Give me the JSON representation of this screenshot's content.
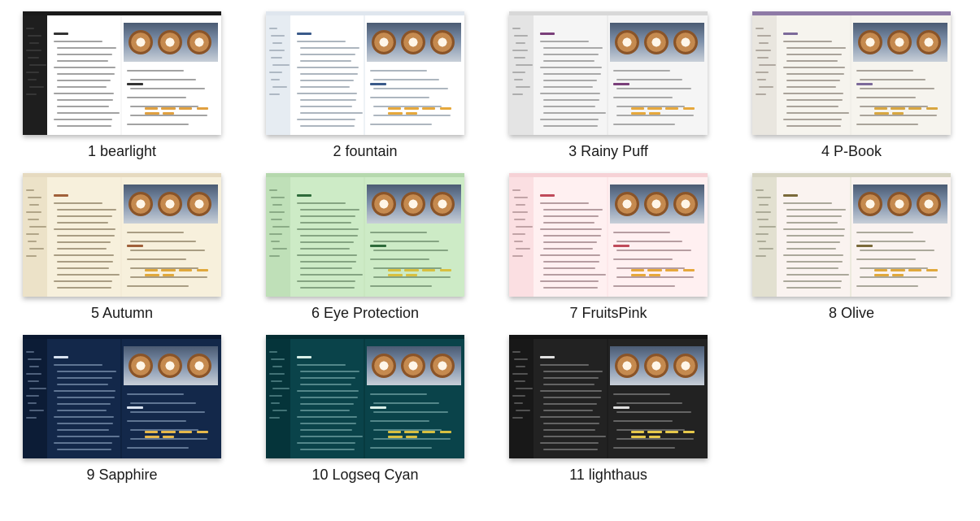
{
  "themes": [
    {
      "label": "1 bearlight",
      "bg": "#f7f7f7",
      "sidebar": "#1e1e1e",
      "page": "#ffffff",
      "text": "#555555",
      "heading": "#333333",
      "accent": "#e0a040",
      "topbar": "#1a1a1a"
    },
    {
      "label": "2 fountain",
      "bg": "#eef2f6",
      "sidebar": "#e6ecf2",
      "page": "#ffffff",
      "text": "#6a7a8a",
      "heading": "#3a5a8a",
      "accent": "#e6a83c",
      "topbar": "#dfe6ee"
    },
    {
      "label": "3 Rainy Puff",
      "bg": "#ececec",
      "sidebar": "#e4e4e4",
      "page": "#f5f5f5",
      "text": "#6a6a6a",
      "heading": "#7a3f7a",
      "accent": "#e6a83c",
      "topbar": "#d8d8d8"
    },
    {
      "label": "4 P-Book",
      "bg": "#f1efe9",
      "sidebar": "#e9e6df",
      "page": "#f6f4ee",
      "text": "#6a6055",
      "heading": "#7c6a9a",
      "accent": "#d8a640",
      "topbar": "#8e7aa6"
    },
    {
      "label": "5 Autumn",
      "bg": "#f4ecd7",
      "sidebar": "#ece2c8",
      "page": "#f7f0dc",
      "text": "#6a5a3a",
      "heading": "#a0603a",
      "accent": "#e0a83c",
      "topbar": "#e6dac0"
    },
    {
      "label": "6 Eye Protection",
      "bg": "#c8e6c0",
      "sidebar": "#bfe0b8",
      "page": "#cdebc6",
      "text": "#4a6a4a",
      "heading": "#2e6a3a",
      "accent": "#d8c040",
      "topbar": "#b5d8ad"
    },
    {
      "label": "7 FruitsPink",
      "bg": "#fde8ea",
      "sidebar": "#fbdfe2",
      "page": "#fff0f1",
      "text": "#7a5a5e",
      "heading": "#c04a5a",
      "accent": "#e6a83c",
      "topbar": "#f6d2d6"
    },
    {
      "label": "8 Olive",
      "bg": "#eceadd",
      "sidebar": "#e2e0d0",
      "page": "#faf3f0",
      "text": "#6a6a55",
      "heading": "#7a6a3a",
      "accent": "#e0a83c",
      "topbar": "#d6d4c2"
    },
    {
      "label": "9 Sapphire",
      "bg": "#0f2240",
      "sidebar": "#0c1c36",
      "page": "#13284a",
      "text": "#9fb4d0",
      "heading": "#d8e2f0",
      "accent": "#e6b84a",
      "topbar": "#0a1830"
    },
    {
      "label": "10 Logseq Cyan",
      "bg": "#073b40",
      "sidebar": "#05343a",
      "page": "#0a434a",
      "text": "#8fbfc0",
      "heading": "#d9efe8",
      "accent": "#d8c040",
      "topbar": "#042d32"
    },
    {
      "label": "11 lighthaus",
      "bg": "#1d1d1d",
      "sidebar": "#181818",
      "page": "#222222",
      "text": "#9a9a9a",
      "heading": "#e0e0e0",
      "accent": "#e6c84a",
      "topbar": "#141414"
    }
  ]
}
